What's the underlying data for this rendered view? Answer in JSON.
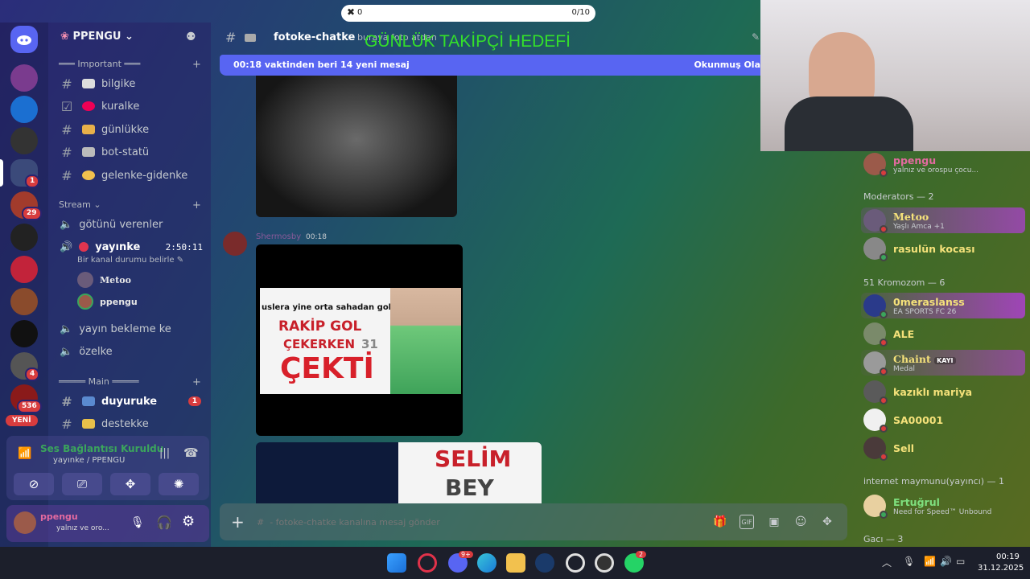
{
  "overlay": {
    "left_value": "0",
    "right_value": "0/10"
  },
  "stream_overlay": {
    "goal_text": "GÜNLÜK TAKİPÇİ HEDEFİ"
  },
  "server": {
    "name": "PPENGU",
    "rail_badges": [
      "1",
      "29",
      "4",
      "536"
    ],
    "new_label": "YENİ"
  },
  "sidebar": {
    "category_important": "═══ Important ═══",
    "channels_top": [
      {
        "name": "bilgike"
      },
      {
        "name": "kuralke"
      },
      {
        "name": "günlükke"
      },
      {
        "name": "bot-statü"
      },
      {
        "name": "gelenke-gidenke"
      }
    ],
    "category_stream": "Stream",
    "voice_channels": [
      {
        "name": "götünü verenler"
      },
      {
        "name": "yayınke",
        "time": "2:50:11",
        "status": "Bir kanal durumu belirle"
      },
      {
        "name": "yayın bekleme ke"
      },
      {
        "name": "özelke"
      }
    ],
    "voice_users": [
      "Metoo",
      "ppengu"
    ],
    "category_main": "═════ Main ═════",
    "channels_main": [
      {
        "name": "duyuruke",
        "badge": "1"
      },
      {
        "name": "destekke"
      }
    ]
  },
  "voice_panel": {
    "status": "Ses Bağlantısı Kuruldu",
    "location": "yayınke / PPENGU"
  },
  "user_panel": {
    "name": "ppengu",
    "status": "yalnız ve oro..."
  },
  "channel": {
    "name": "fotoke-chatke",
    "topic": "buraya foto atdan"
  },
  "banner": {
    "text": "00:18 vaktinden beri 14 yeni mesaj",
    "action": "Okunmuş Ola"
  },
  "message": {
    "author": "Shermosby",
    "time": "00:18",
    "meme_line": "uslera yine orta sahadan gol yedi",
    "meme_big1": "RAKİP GOL",
    "meme_big2": "ÇEKERKEN",
    "meme_num": "31",
    "meme_big3": "ÇEKTİ",
    "meme2_line1": "SELİM",
    "meme2_line2": "BEY"
  },
  "composer": {
    "placeholder": "#  - fotoke-chatke kanalına mesaj gönder",
    "gif_label": "GIF"
  },
  "members": {
    "top": {
      "name": "ppengu",
      "sub": "yalnız ve orospu çocu..."
    },
    "groups": [
      {
        "title": "Moderators — 2",
        "members": [
          {
            "name": "Metoo",
            "sub": "Yaşlı Amca +1",
            "color": "#f5e27a"
          },
          {
            "name": "rasulün kocası",
            "sub": "",
            "color": "#f5e27a"
          }
        ]
      },
      {
        "title": "51 Kromozom — 6",
        "members": [
          {
            "name": "0meraslanss",
            "sub": "EA SPORTS FC 26",
            "color": "#f5e27a"
          },
          {
            "name": "ALE",
            "sub": "",
            "color": "#f5e27a"
          },
          {
            "name": "Chaint",
            "sub": "Medal",
            "tag": "KAYI",
            "color": "#f5e27a"
          },
          {
            "name": "kazıklı mariya",
            "sub": "",
            "color": "#f5e27a"
          },
          {
            "name": "SA00001",
            "sub": "",
            "color": "#f5e27a"
          },
          {
            "name": "Sell",
            "sub": "",
            "color": "#f5e27a"
          }
        ]
      },
      {
        "title": "internet maymunu(yayıncı) — 1",
        "members": [
          {
            "name": "Ertuğrul",
            "sub": "Need for Speed™ Unbound",
            "color": "#7ee07e"
          }
        ]
      },
      {
        "title": "Gacı — 3",
        "members": []
      }
    ]
  },
  "taskbar": {
    "time": "00:19",
    "date": "31.12.2025",
    "discord_badge": "9+",
    "whatsapp_badge": "2"
  }
}
